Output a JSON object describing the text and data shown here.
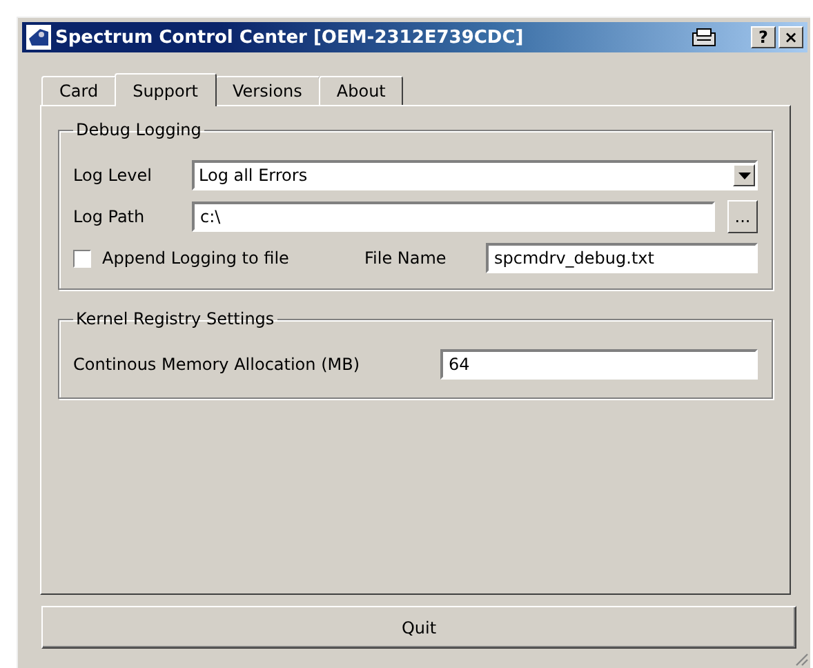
{
  "window": {
    "title": "Spectrum Control Center [OEM-2312E739CDC]",
    "buttons": [
      "?",
      "×"
    ]
  },
  "tabs": [
    {
      "label": "Card",
      "selected": false
    },
    {
      "label": "Support",
      "selected": true
    },
    {
      "label": "Versions",
      "selected": false
    },
    {
      "label": "About",
      "selected": false
    }
  ],
  "debug_logging": {
    "title": "Debug Logging",
    "log_level": {
      "label": "Log Level",
      "value": "Log all Errors"
    },
    "log_path": {
      "label": "Log Path",
      "value": "c:\\",
      "browse": "..."
    },
    "append": {
      "label": "Append Logging to file",
      "checked": false
    },
    "file_name": {
      "label": "File Name",
      "value": "spcmdrv_debug.txt"
    }
  },
  "kernel_registry": {
    "title": "Kernel Registry Settings",
    "memory": {
      "label": "Continous Memory Allocation (MB)",
      "value": "64"
    }
  },
  "buttons": [
    "Quit"
  ]
}
